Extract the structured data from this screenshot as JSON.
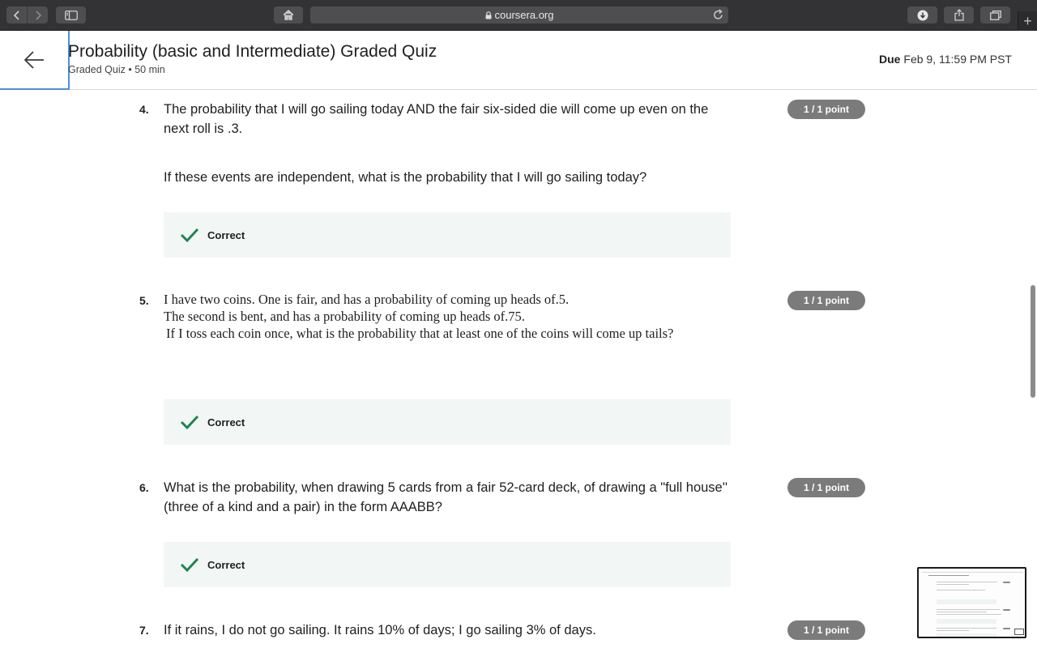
{
  "browser": {
    "url": "coursera.org",
    "icons": {
      "back": "chevron-left-icon",
      "forward": "chevron-right-icon",
      "sidebar": "sidebar-icon",
      "home": "home-icon",
      "lock": "lock-icon",
      "reload": "reload-icon",
      "download": "download-icon",
      "share": "share-icon",
      "tabs": "tabs-icon",
      "new_tab": "plus-icon"
    },
    "new_tab_label": "+"
  },
  "header": {
    "title": "Probability (basic and Intermediate) Graded Quiz",
    "subtitle": "Graded Quiz • 50 min",
    "due_label": "Due",
    "due_value": "Feb 9, 11:59 PM PST"
  },
  "questions": [
    {
      "number": "4.",
      "text": "The probability that I will go sailing today AND the fair six-sided die will come up even on the next roll is .3.",
      "followup": "If these events are independent, what is the probability that I will go sailing today?",
      "points": "1 / 1 point",
      "feedback": "Correct"
    },
    {
      "number": "5.",
      "lines": [
        "I have two coins. One is fair, and has a probability of coming up heads of.5.",
        "The second is bent, and has a probability of coming up heads of.75.",
        "If I toss each coin once, what is the probability that at least one of the coins will come up tails?"
      ],
      "points": "1 / 1 point",
      "feedback": "Correct"
    },
    {
      "number": "6.",
      "text": "What is the probability, when drawing 5 cards from a fair 52-card deck, of drawing a \"full house'' (three of a kind and a pair) in the form AAABB?",
      "points": "1 / 1 point",
      "feedback": "Correct"
    },
    {
      "number": "7.",
      "text": "If it rains, I do not go sailing. It rains 10% of days; I go sailing 3% of days.",
      "points": "1 / 1 point"
    }
  ],
  "colors": {
    "accent_check": "#1f8354",
    "points_badge": "#7b7b7b",
    "feedback_bg": "#f2f7f5",
    "focus_outline": "#4a8fe0"
  }
}
